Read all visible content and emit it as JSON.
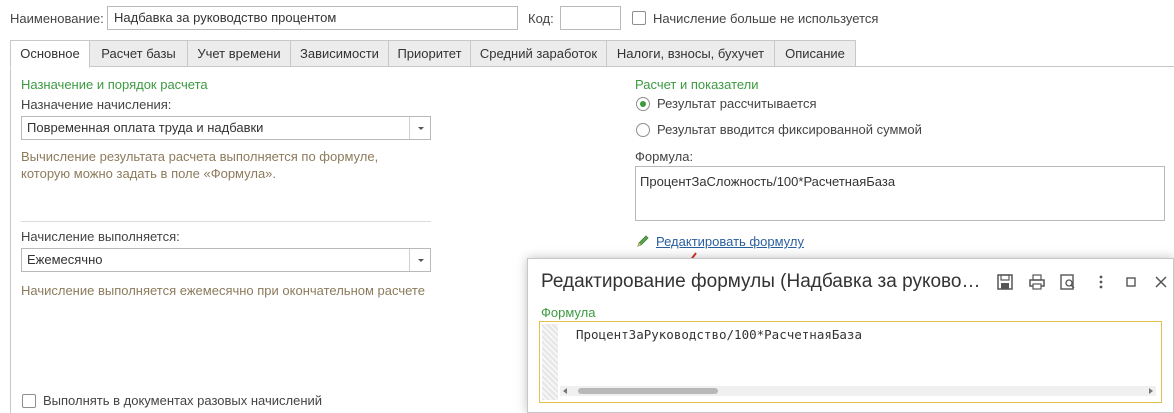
{
  "header": {
    "name_label": "Наименование:",
    "name_value": "Надбавка за руководство процентом",
    "code_label": "Код:",
    "code_value": "",
    "unused_label": "Начисление больше не используется"
  },
  "tabs": [
    {
      "label": "Основное"
    },
    {
      "label": "Расчет базы"
    },
    {
      "label": "Учет времени"
    },
    {
      "label": "Зависимости"
    },
    {
      "label": "Приоритет"
    },
    {
      "label": "Средний заработок"
    },
    {
      "label": "Налоги, взносы, бухучет"
    },
    {
      "label": "Описание"
    }
  ],
  "left": {
    "section_title": "Назначение и порядок расчета",
    "purpose_label": "Назначение начисления:",
    "purpose_value": "Повременная оплата труда и надбавки",
    "hint1_line1": "Вычисление результата расчета выполняется по формуле,",
    "hint1_line2": "которую можно задать в поле «Формула».",
    "exec_label": "Начисление выполняется:",
    "exec_value": "Ежемесячно",
    "hint2": "Начисление выполняется ежемесячно при окончательном расчете",
    "onetime_label": "Выполнять в документах разовых начислений"
  },
  "right": {
    "section_title": "Расчет и показатели",
    "radio_calculated": "Результат рассчитывается",
    "radio_fixed": "Результат вводится фиксированной суммой",
    "formula_label": "Формула:",
    "formula_value": "ПроцентЗаСложность/100*РасчетнаяБаза",
    "edit_link": "Редактировать формулу"
  },
  "dialog": {
    "title": "Редактирование формулы (Надбавка за руково…",
    "formula_label": "Формула",
    "formula_code": "ПроцентЗаРуководство/100*РасчетнаяБаза"
  },
  "colors": {
    "accent_green": "#3c9a41",
    "hint_text": "#8c7b5c",
    "link_blue": "#2a5f9e",
    "arrow_red": "#d9342b",
    "focus_yellow": "#e2c04d"
  },
  "icons": [
    "save-icon",
    "print-icon",
    "preview-icon",
    "more-icon",
    "maximize-icon",
    "close-icon",
    "pencil-icon"
  ]
}
